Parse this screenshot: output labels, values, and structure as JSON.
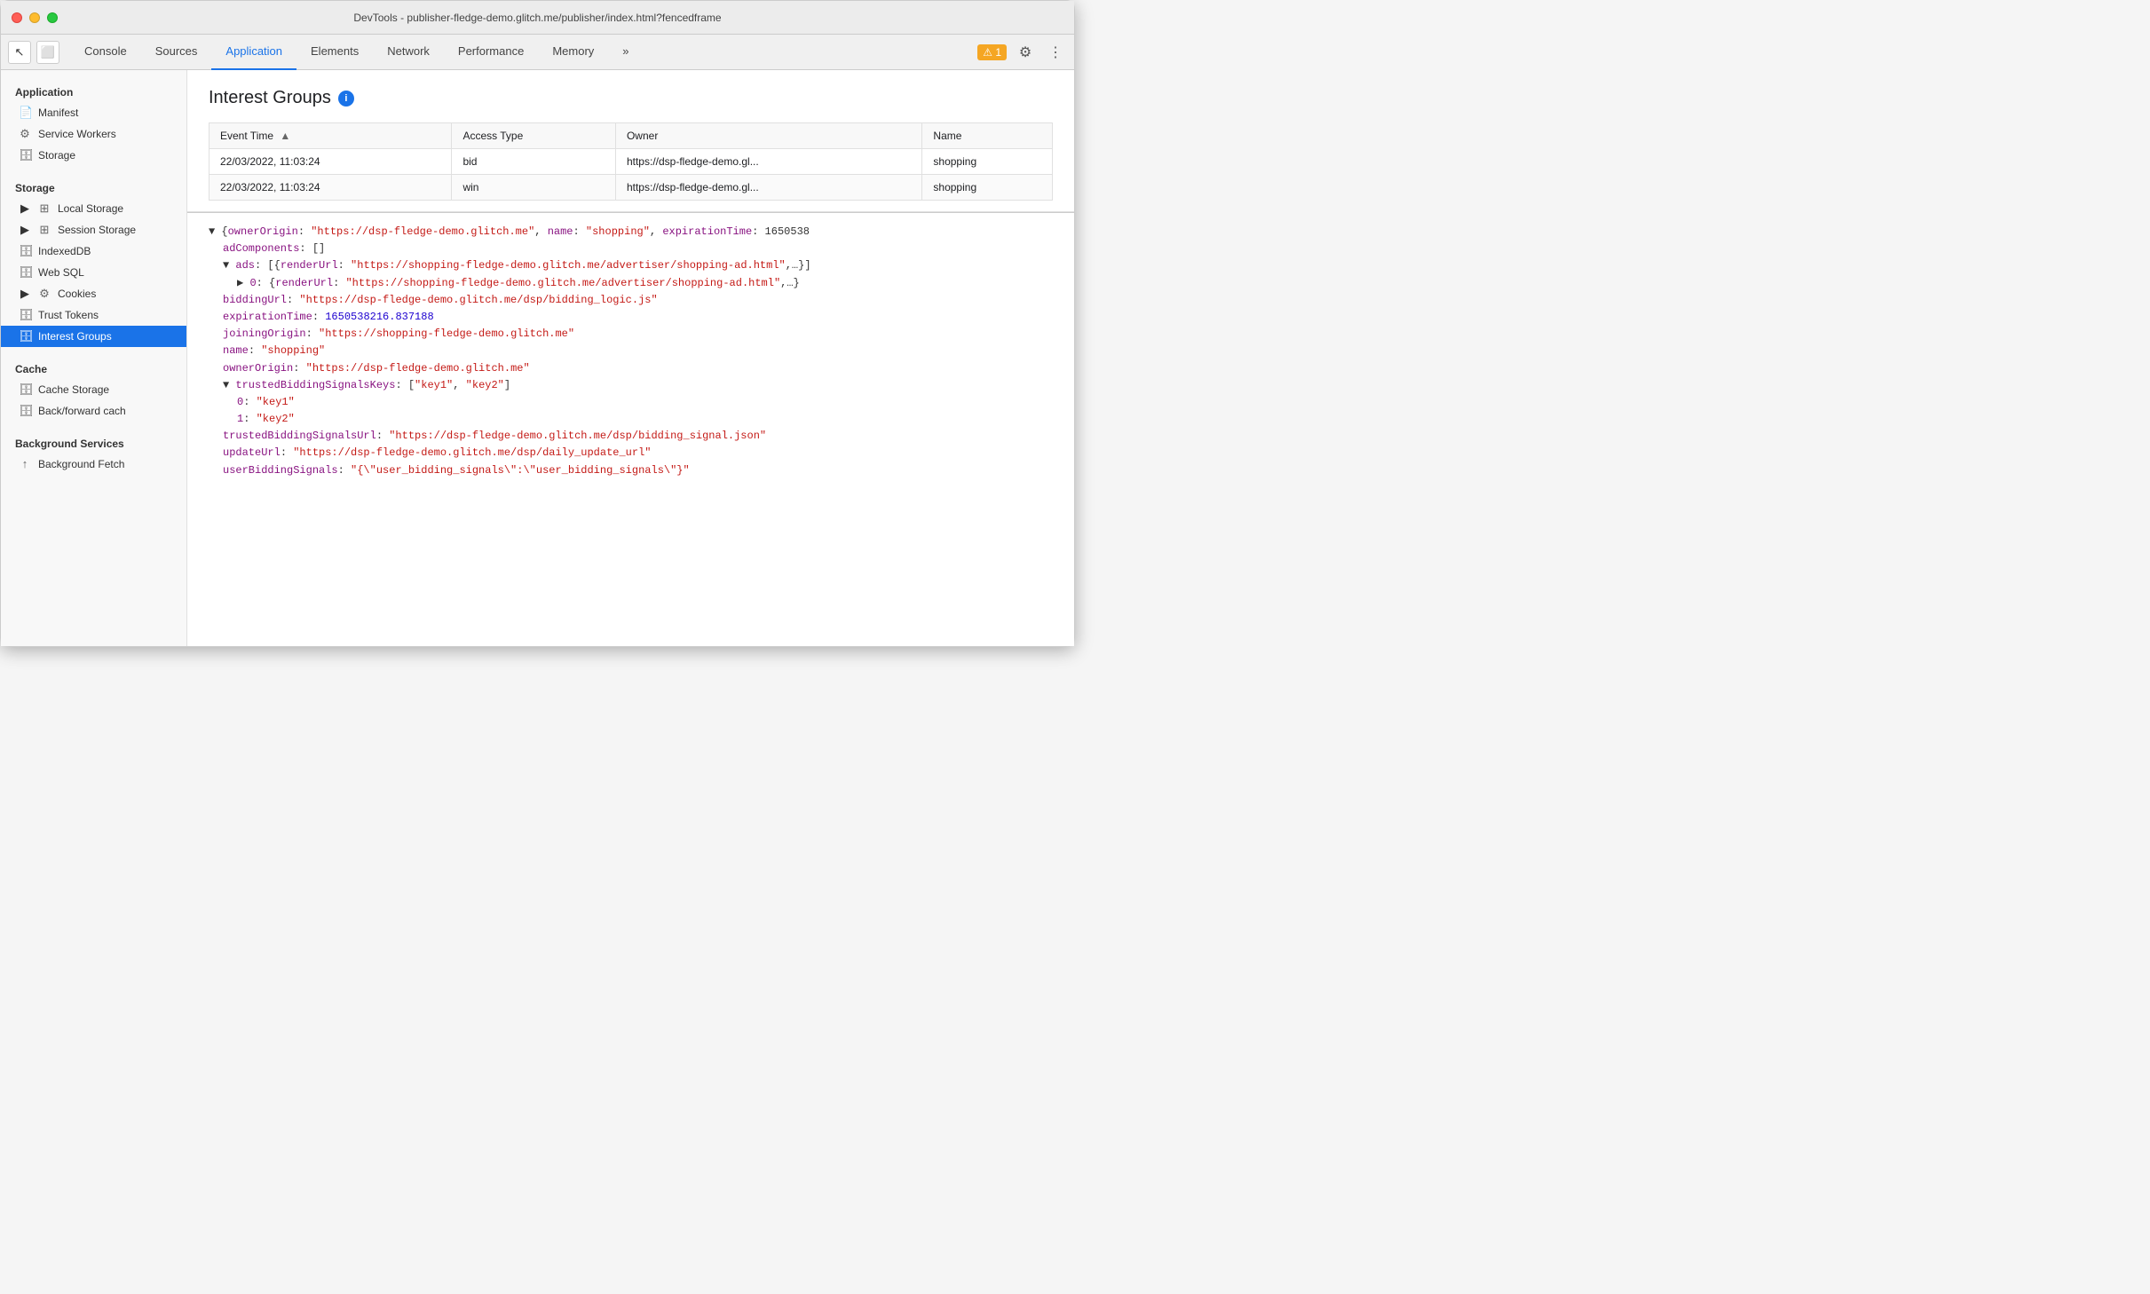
{
  "titleBar": {
    "title": "DevTools - publisher-fledge-demo.glitch.me/publisher/index.html?fencedframe"
  },
  "tabs": {
    "items": [
      {
        "label": "Console",
        "active": false
      },
      {
        "label": "Sources",
        "active": false
      },
      {
        "label": "Application",
        "active": true
      },
      {
        "label": "Elements",
        "active": false
      },
      {
        "label": "Network",
        "active": false
      },
      {
        "label": "Performance",
        "active": false
      },
      {
        "label": "Memory",
        "active": false
      }
    ],
    "more_label": "»",
    "warning_count": "⚠ 1"
  },
  "sidebar": {
    "application_section": "Application",
    "application_items": [
      {
        "label": "Manifest",
        "icon": "📄"
      },
      {
        "label": "Service Workers",
        "icon": "⚙"
      },
      {
        "label": "Storage",
        "icon": "🗄"
      }
    ],
    "storage_section": "Storage",
    "storage_items": [
      {
        "label": "Local Storage",
        "icon": "▶",
        "has_arrow": true
      },
      {
        "label": "Session Storage",
        "icon": "▶",
        "has_arrow": true
      },
      {
        "label": "IndexedDB",
        "icon": "🗄"
      },
      {
        "label": "Web SQL",
        "icon": "🗄"
      },
      {
        "label": "Cookies",
        "icon": "▶",
        "has_arrow": true
      },
      {
        "label": "Trust Tokens",
        "icon": "🗄"
      },
      {
        "label": "Interest Groups",
        "icon": "🗄",
        "active": true
      }
    ],
    "cache_section": "Cache",
    "cache_items": [
      {
        "label": "Cache Storage",
        "icon": "🗄"
      },
      {
        "label": "Back/forward cach",
        "icon": "🗄"
      }
    ],
    "background_section": "Background Services",
    "background_items": [
      {
        "label": "Background Fetch",
        "icon": "↑"
      }
    ]
  },
  "interestGroups": {
    "title": "Interest Groups",
    "table": {
      "headers": [
        "Event Time",
        "Access Type",
        "Owner",
        "Name"
      ],
      "rows": [
        [
          "22/03/2022, 11:03:24",
          "bid",
          "https://dsp-fledge-demo.gl...",
          "shopping"
        ],
        [
          "22/03/2022, 11:03:24",
          "win",
          "https://dsp-fledge-demo.gl...",
          "shopping"
        ]
      ]
    }
  },
  "detail": {
    "lines": [
      {
        "text": "{ownerOrigin: \"https://dsp-fledge-demo.glitch.me\", name: \"shopping\", expirationTime: 1650538",
        "type": "root-open"
      },
      {
        "text": "adComponents: []",
        "type": "key-value",
        "indent": 1
      },
      {
        "text": "ads: [{renderUrl: \"https://shopping-fledge-demo.glitch.me/advertiser/shopping-ad.html\",…}]",
        "type": "expand",
        "indent": 1
      },
      {
        "text": "▶ 0: {renderUrl: \"https://shopping-fledge-demo.glitch.me/advertiser/shopping-ad.html\",…}",
        "type": "sub-expand",
        "indent": 2
      },
      {
        "text": "biddingUrl: \"https://dsp-fledge-demo.glitch.me/dsp/bidding_logic.js\"",
        "type": "link-value",
        "indent": 1,
        "key": "biddingUrl",
        "val": "\"https://dsp-fledge-demo.glitch.me/dsp/bidding_logic.js\""
      },
      {
        "text": "expirationTime: 1650538216.837188",
        "type": "num-value",
        "indent": 1,
        "key": "expirationTime",
        "val": "1650538216.837188"
      },
      {
        "text": "joiningOrigin: \"https://shopping-fledge-demo.glitch.me\"",
        "type": "link-value",
        "indent": 1,
        "key": "joiningOrigin",
        "val": "\"https://shopping-fledge-demo.glitch.me\""
      },
      {
        "text": "name: \"shopping\"",
        "type": "str-value",
        "indent": 1,
        "key": "name",
        "val": "\"shopping\""
      },
      {
        "text": "ownerOrigin: \"https://dsp-fledge-demo.glitch.me\"",
        "type": "link-value",
        "indent": 1,
        "key": "ownerOrigin",
        "val": "\"https://dsp-fledge-demo.glitch.me\""
      },
      {
        "text": "▼ trustedBiddingSignalsKeys: [\"key1\", \"key2\"]",
        "type": "expand-open",
        "indent": 1
      },
      {
        "text": "0: \"key1\"",
        "type": "str-value",
        "indent": 2,
        "key": "0",
        "val": "\"key1\""
      },
      {
        "text": "1: \"key2\"",
        "type": "str-value",
        "indent": 2,
        "key": "1",
        "val": "\"key2\""
      },
      {
        "text": "trustedBiddingSignalsUrl: \"https://dsp-fledge-demo.glitch.me/dsp/bidding_signal.json\"",
        "type": "link-value",
        "indent": 1,
        "key": "trustedBiddingSignalsUrl",
        "val": "\"https://dsp-fledge-demo.glitch.me/dsp/bidding_signal.json\""
      },
      {
        "text": "updateUrl: \"https://dsp-fledge-demo.glitch.me/dsp/daily_update_url\"",
        "type": "link-value",
        "indent": 1,
        "key": "updateUrl",
        "val": "\"https://dsp-fledge-demo.glitch.me/dsp/daily_update_url\""
      },
      {
        "text": "userBiddingSignals: \"{\\\"user_bidding_signals\\\":\\\"user_bidding_signals\\\"}\"",
        "type": "str-value",
        "indent": 1,
        "key": "userBiddingSignals",
        "val": "\"{\\\"user_bidding_signals\\\":\\\"user_bidding_signals\\\"}\""
      }
    ]
  }
}
